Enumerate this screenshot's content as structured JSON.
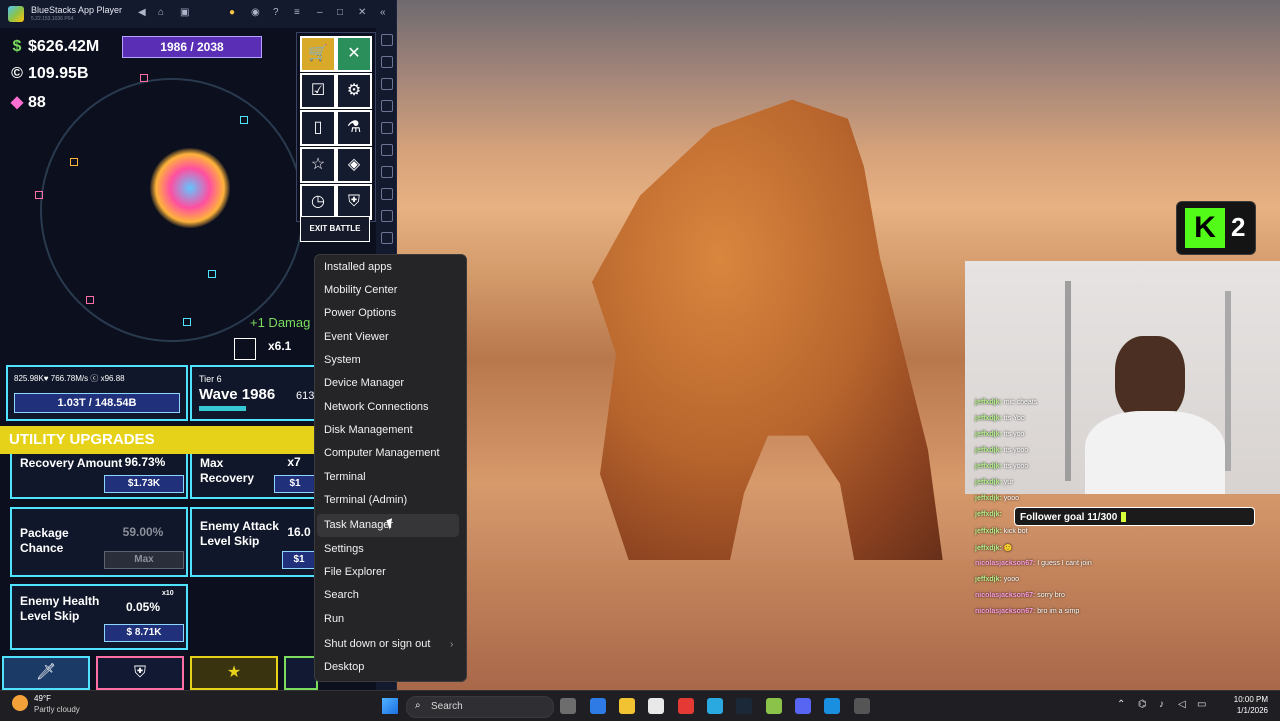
{
  "bluestacks": {
    "title": "BlueStacks App Player",
    "version": "5.22.153.1036 P64"
  },
  "game": {
    "cash": "$626.42M",
    "coins": "109.95B",
    "gems": "88",
    "wave_progress": "1986 / 2038",
    "buttons": [
      "shop",
      "close",
      "checklist",
      "settings",
      "card",
      "lab",
      "star",
      "module",
      "history",
      "shield"
    ],
    "exit_battle": "EXIT BATTLE",
    "damage_popup": "+1 Damag",
    "speed": "x6.1",
    "health_stats": "825.98K♥ 766.78M/s ⓒ x96.88",
    "health_bar": "1.03T / 148.54B",
    "tier_label": "Tier 6",
    "wave_label": "Wave 1986",
    "wave_extra": "613",
    "tier_progress": 0.42,
    "section_title": "UTILITY UPGRADES",
    "cards": [
      {
        "label": "Recovery Amount",
        "value": "96.73%",
        "cost": "$1.73K"
      },
      {
        "label": "Max Recovery",
        "value": "x7",
        "cost": "$1"
      },
      {
        "label": "Package Chance",
        "value": "59.00%",
        "cost": "Max"
      },
      {
        "label": "Enemy Attack Level Skip",
        "value": "16.0",
        "cost": "$1"
      },
      {
        "label": "Enemy Health Level Skip",
        "value": "0.05%",
        "cost": "$ 8.71K",
        "badge": "x10"
      }
    ]
  },
  "context_menu": {
    "items": [
      "Installed apps",
      "Mobility Center",
      "Power Options",
      "Event Viewer",
      "System",
      "Device Manager",
      "Network Connections",
      "Disk Management",
      "Computer Management",
      "Terminal",
      "Terminal (Admin)",
      "Task Manager",
      "Settings",
      "File Explorer",
      "Search",
      "Run",
      "Shut down or sign out",
      "Desktop"
    ],
    "highlighted": "Task Manager"
  },
  "stream_overlay": {
    "kick_count": "2",
    "follower_goal": "Follower goal 11/300",
    "follower_progress": 0.037,
    "chat": [
      {
        "user": "jeffxdjk:",
        "msg": "mic cheats"
      },
      {
        "user": "jeffxdjk:",
        "msg": "tts Yoo"
      },
      {
        "user": "jeffxdjk:",
        "msg": "tts yoo"
      },
      {
        "user": "jeffxdjk:",
        "msg": "tts yooo"
      },
      {
        "user": "jeffxdjk:",
        "msg": "tts yooo"
      },
      {
        "user": "jeffxdjk:",
        "msg": "yur"
      },
      {
        "user": "jeffxdjk:",
        "msg": "yooo"
      },
      {
        "user": "jeffxdjk:",
        "msg": ""
      },
      {
        "user": "jeffxdjk:",
        "msg": "kick bot"
      },
      {
        "user": "jeffxdjk:",
        "msg": "🙂"
      },
      {
        "user": "nicolasjackson67:",
        "msg": "I guess I cant join"
      },
      {
        "user": "jeffxdjk:",
        "msg": "yooo"
      },
      {
        "user": "nicolasjackson67:",
        "msg": "sorry bro"
      },
      {
        "user": "nicolasjackson67:",
        "msg": "bro im a simp"
      }
    ]
  },
  "taskbar": {
    "temp": "49°F",
    "weather": "Partly cloudy",
    "search_placeholder": "Search",
    "time": "10:00 PM",
    "date": "1/1/2026"
  }
}
